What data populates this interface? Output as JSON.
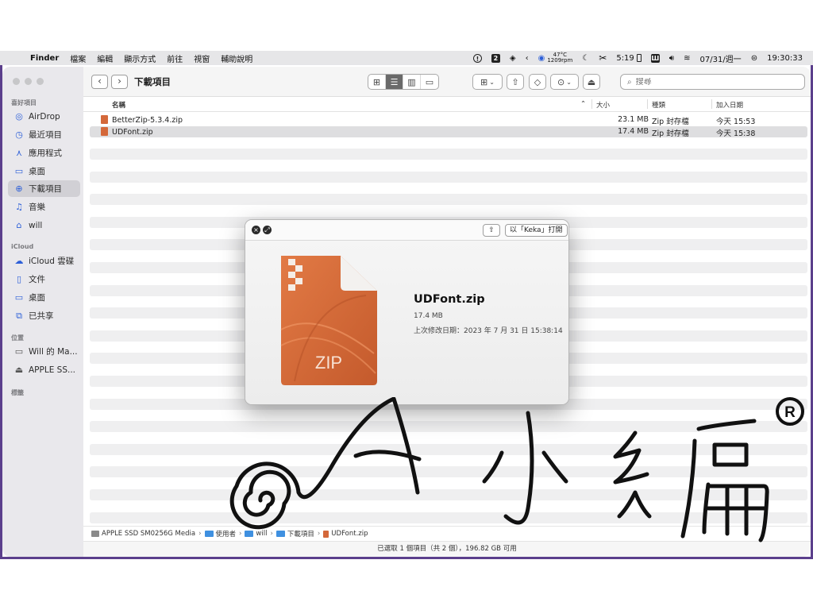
{
  "menubar": {
    "app_name": "Finder",
    "menus": [
      "檔案",
      "編輯",
      "顯示方式",
      "前往",
      "視窗",
      "輔助說明"
    ],
    "status": {
      "badge_number": "2",
      "temperature": "47°C",
      "fan_speed": "1209rpm",
      "battery_time": "5:19",
      "date": "07/31/週一",
      "time": "19:30:33"
    }
  },
  "sidebar": {
    "favorites_header": "喜好項目",
    "favorites": [
      {
        "label": "AirDrop",
        "icon": "airdrop-icon"
      },
      {
        "label": "最近項目",
        "icon": "clock-icon"
      },
      {
        "label": "應用程式",
        "icon": "applications-icon"
      },
      {
        "label": "桌面",
        "icon": "desktop-icon"
      },
      {
        "label": "下載項目",
        "icon": "download-icon",
        "active": true
      },
      {
        "label": "音樂",
        "icon": "music-icon"
      },
      {
        "label": "will",
        "icon": "home-icon"
      }
    ],
    "icloud_header": "iCloud",
    "icloud": [
      {
        "label": "iCloud 雲碟",
        "icon": "cloud-icon"
      },
      {
        "label": "文件",
        "icon": "document-icon"
      },
      {
        "label": "桌面",
        "icon": "desktop-icon"
      },
      {
        "label": "已共享",
        "icon": "shared-folder-icon"
      }
    ],
    "locations_header": "位置",
    "locations": [
      {
        "label": "Will 的 Ma...",
        "icon": "laptop-icon"
      },
      {
        "label": "APPLE SS...",
        "icon": "drive-icon"
      }
    ],
    "tags_header": "標籤"
  },
  "toolbar": {
    "title": "下載項目",
    "search_placeholder": "搜尋"
  },
  "columns": {
    "name": "名稱",
    "size": "大小",
    "kind": "種類",
    "date_added": "加入日期"
  },
  "files": [
    {
      "name": "BetterZip-5.3.4.zip",
      "size": "23.1 MB",
      "kind": "Zip 封存檔",
      "date_added": "今天 15:53"
    },
    {
      "name": "UDFont.zip",
      "size": "17.4 MB",
      "kind": "Zip 封存檔",
      "date_added": "今天 15:38",
      "selected": true
    }
  ],
  "pathbar": {
    "items": [
      "APPLE SSD SM0256G Media",
      "使用者",
      "will",
      "下載項目",
      "UDFont.zip"
    ]
  },
  "statusbar": {
    "text": "已選取 1 個項目（共 2 個），196.82 GB 可用"
  },
  "quicklook": {
    "open_with_label": "以「Keka」打開",
    "file_name": "UDFont.zip",
    "file_size": "17.4 MB",
    "modified": "上次修改日期：2023 年 7 月 31 日 15:38:14",
    "icon_label": "ZIP"
  },
  "watermark": {
    "text": "A 小編",
    "registered_mark": "R"
  },
  "colors": {
    "accent": "#2d5fd8",
    "desktop": "#5b3f8c",
    "zip_orange": "#d4683a"
  }
}
